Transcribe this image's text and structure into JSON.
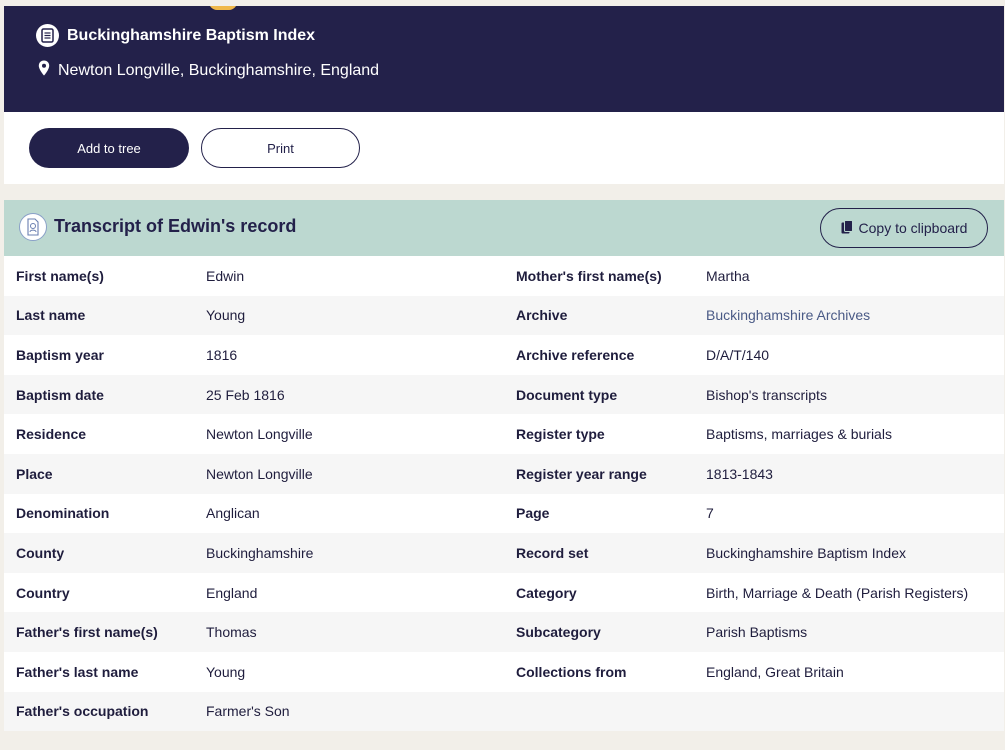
{
  "header": {
    "collection_title": "Buckinghamshire Baptism Index",
    "location": "Newton Longville, Buckinghamshire, England",
    "collection_icon": "document-icon",
    "location_icon": "map-pin-icon",
    "background_color": "#23214a"
  },
  "actions": {
    "add_to_tree": "Add to tree",
    "print": "Print"
  },
  "transcript": {
    "title": "Transcript of Edwin's record",
    "copy_label": "Copy to clipboard",
    "header_color": "#bcd8d0",
    "rows": [
      {
        "l1": "First name(s)",
        "v1": "Edwin",
        "l2": "Mother's first name(s)",
        "v2": "Martha"
      },
      {
        "l1": "Last name",
        "v1": "Young",
        "l2": "Archive",
        "v2": "Buckinghamshire Archives"
      },
      {
        "l1": "Baptism year",
        "v1": "1816",
        "l2": "Archive reference",
        "v2": "D/A/T/140"
      },
      {
        "l1": "Baptism date",
        "v1": "25 Feb 1816",
        "l2": "Document type",
        "v2": "Bishop's transcripts"
      },
      {
        "l1": "Residence",
        "v1": "Newton Longville",
        "l2": "Register type",
        "v2": "Baptisms, marriages & burials"
      },
      {
        "l1": "Place",
        "v1": "Newton Longville",
        "l2": "Register year range",
        "v2": "1813-1843"
      },
      {
        "l1": "Denomination",
        "v1": "Anglican",
        "l2": "Page",
        "v2": "7"
      },
      {
        "l1": "County",
        "v1": "Buckinghamshire",
        "l2": "Record set",
        "v2": "Buckinghamshire Baptism Index"
      },
      {
        "l1": "Country",
        "v1": "England",
        "l2": "Category",
        "v2": "Birth, Marriage & Death (Parish Registers)"
      },
      {
        "l1": "Father's first name(s)",
        "v1": "Thomas",
        "l2": "Subcategory",
        "v2": "Parish Baptisms"
      },
      {
        "l1": "Father's last name",
        "v1": "Young",
        "l2": "Collections from",
        "v2": "England, Great Britain"
      },
      {
        "l1": "Father's occupation",
        "v1": "Farmer's Son",
        "l2": "",
        "v2": ""
      }
    ]
  }
}
